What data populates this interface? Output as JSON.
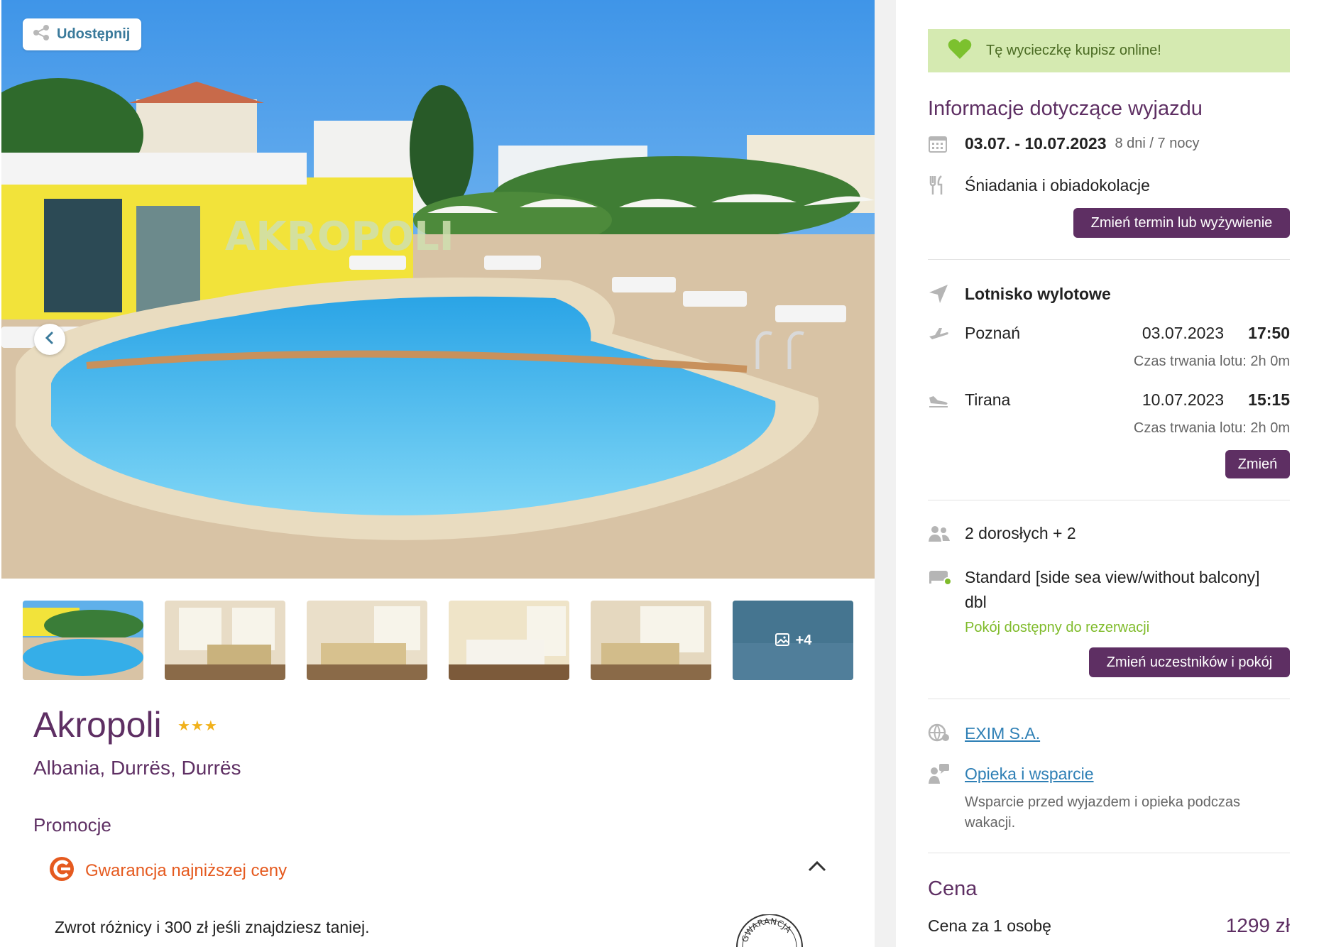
{
  "share": {
    "label": "Udostępnij",
    "icon": "share-icon"
  },
  "gallery": {
    "more_label": "+4"
  },
  "hotel": {
    "name": "Akropoli",
    "stars": "★★★",
    "location": "Albania, Durrës, Durrës",
    "sign_text": "AKROPOLI"
  },
  "promotions": {
    "title": "Promocje",
    "guarantee_label": "Gwarancja najniższej ceny",
    "refund_text": "Zwrot różnicy i 300 zł jeśli znajdziesz taniej.",
    "stamp_text": "GWARANCJA"
  },
  "sidebar": {
    "online_banner": "Tę wycieczkę kupisz online!",
    "trip_info_title": "Informacje dotyczące wyjazdu",
    "dates": "03.07. - 10.07.2023",
    "duration": "8 dni / 7 nocy",
    "board": "Śniadania i obiadokolacje",
    "change_term_button": "Zmień termin lub wyżywienie",
    "departure_airport_label": "Lotnisko wylotowe",
    "outbound": {
      "city": "Poznań",
      "date": "03.07.2023",
      "time": "17:50",
      "duration": "Czas trwania lotu: 2h 0m"
    },
    "inbound": {
      "city": "Tirana",
      "date": "10.07.2023",
      "time": "15:15",
      "duration": "Czas trwania lotu: 2h 0m"
    },
    "change_flight_button": "Zmień",
    "participants": "2 dorosłych + 2",
    "room_line1": "Standard [side sea view/without balcony]",
    "room_line2": "dbl",
    "room_status": "Pokój dostępny do rezerwacji",
    "change_participants_button": "Zmień uczestników i pokój",
    "operator_link": "EXIM S.A.",
    "support_link": "Opieka i wsparcie",
    "support_desc_line1": "Wsparcie przed wyjazdem i opieka podczas",
    "support_desc_line2": "wakacji.",
    "price_title": "Cena",
    "price_per_person_label": "Cena za 1 osobę",
    "price_per_person_value": "1299 zł"
  },
  "colors": {
    "brand_purple": "#5e2f63",
    "banner_green_bg": "#d5eab1",
    "status_green": "#7fbb2a",
    "guarantee_orange": "#e55a1f",
    "link_blue": "#2e7fb5",
    "star_gold": "#f1b11b"
  }
}
